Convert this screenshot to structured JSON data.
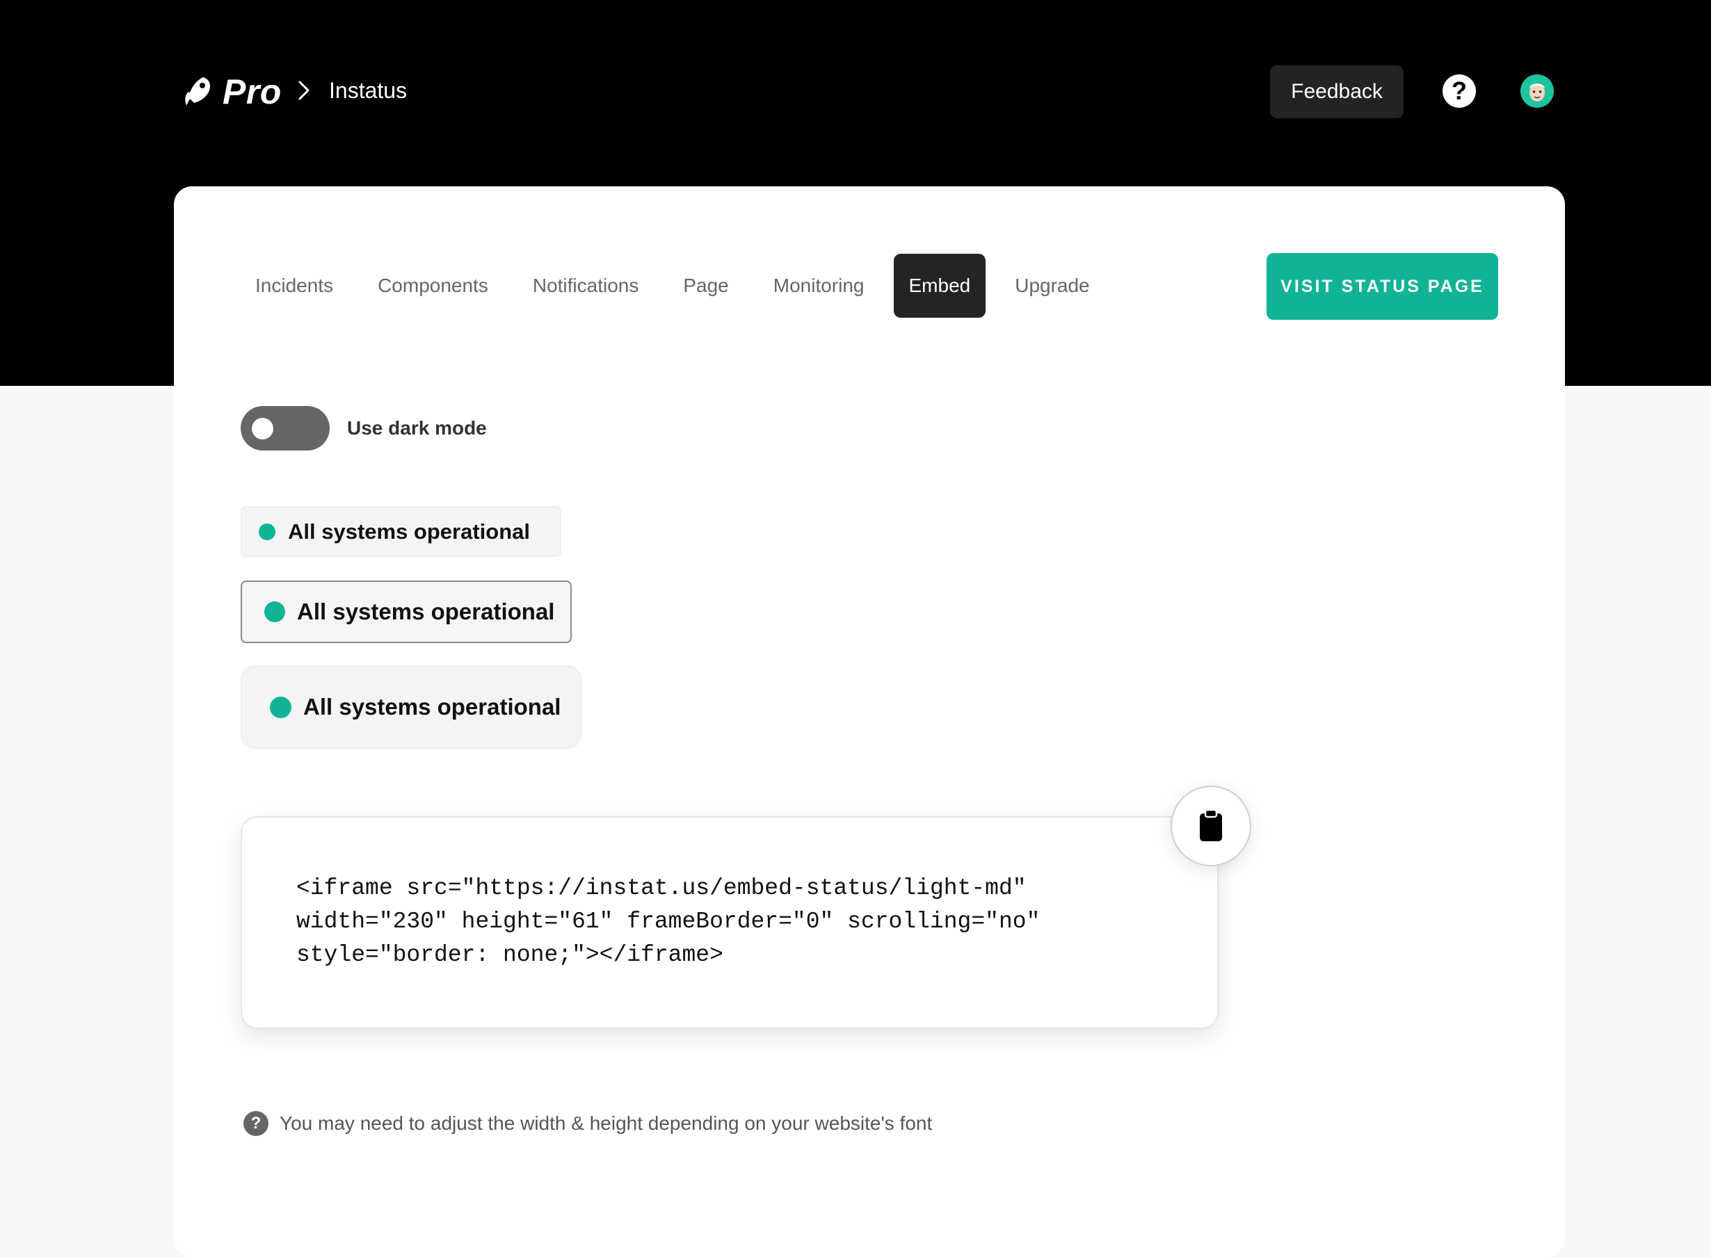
{
  "header": {
    "logo_text": "Pro",
    "breadcrumb": "Instatus",
    "feedback_label": "Feedback",
    "help_symbol": "?"
  },
  "nav": {
    "tabs": [
      {
        "label": "Incidents",
        "active": false
      },
      {
        "label": "Components",
        "active": false
      },
      {
        "label": "Notifications",
        "active": false
      },
      {
        "label": "Page",
        "active": false
      },
      {
        "label": "Monitoring",
        "active": false
      },
      {
        "label": "Embed",
        "active": true
      },
      {
        "label": "Upgrade",
        "active": false
      }
    ],
    "visit_label": "VISIT STATUS PAGE"
  },
  "settings": {
    "dark_mode_label": "Use dark mode",
    "dark_mode_on": false
  },
  "previews": {
    "small": "All systems operational",
    "medium": "All systems operational",
    "large": "All systems operational"
  },
  "embed_code": "<iframe src=\"https://instat.us/embed-status/light-md\"\nwidth=\"230\" height=\"61\" frameBorder=\"0\" scrolling=\"no\"\nstyle=\"border: none;\"></iframe>",
  "hint": {
    "icon": "?",
    "text": "You may need to adjust the width & height depending on your website's font"
  },
  "colors": {
    "accent": "#10b396",
    "header_bg": "#000000",
    "active_tab": "#242424"
  },
  "icons": [
    "rocket-logo-icon",
    "chevron-right-icon",
    "help-icon",
    "avatar",
    "clipboard-icon",
    "question-icon"
  ]
}
